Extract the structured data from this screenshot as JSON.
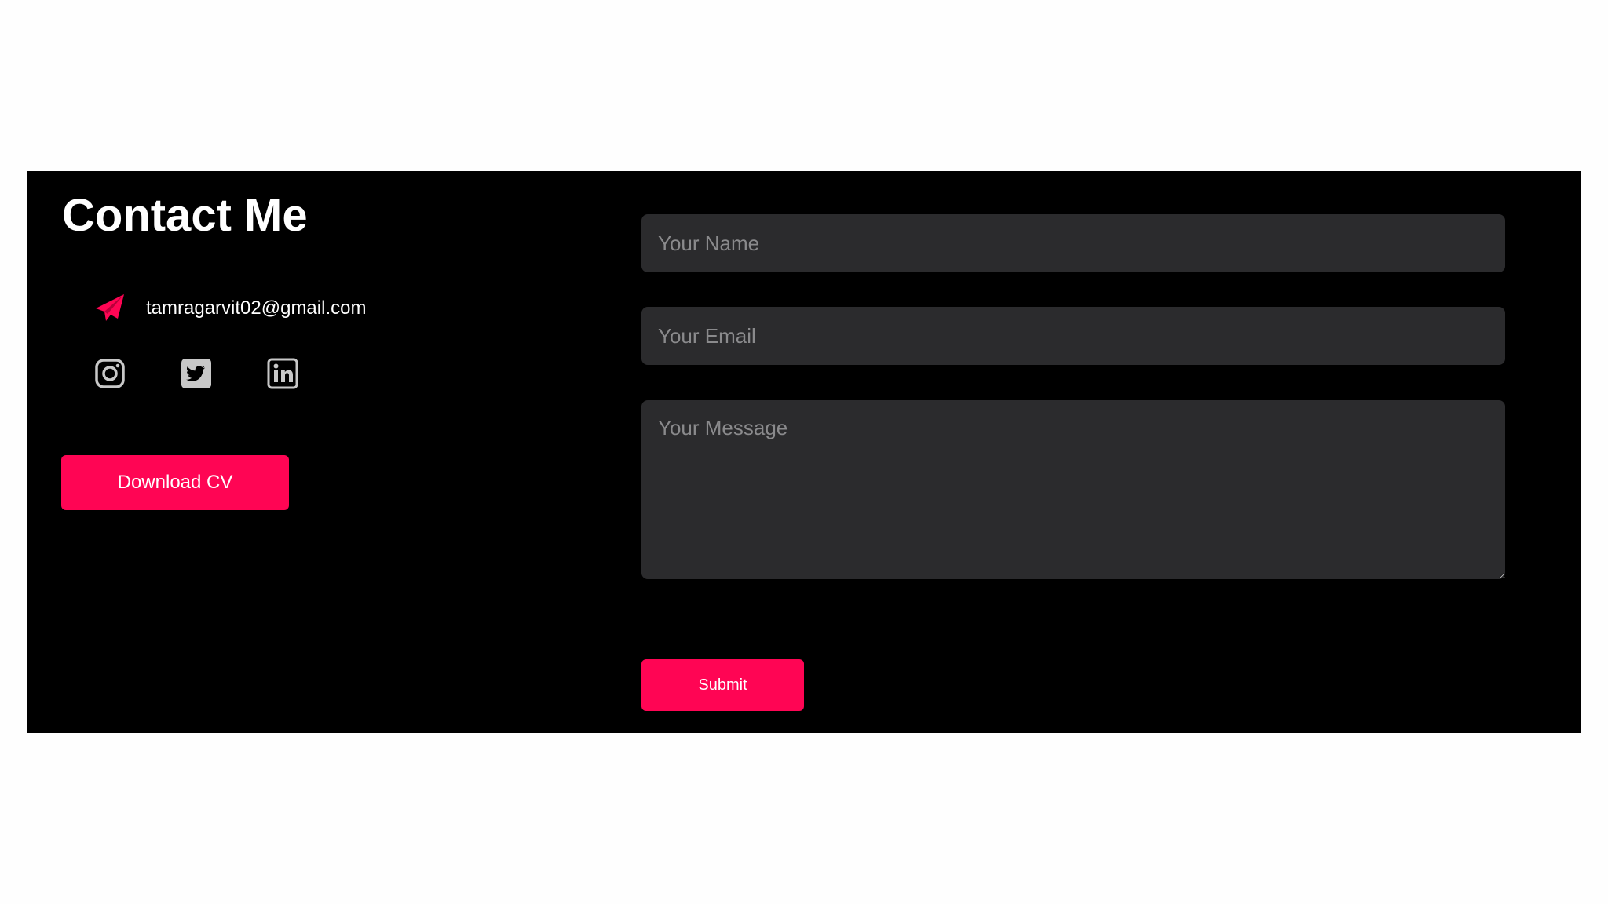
{
  "contact": {
    "title": "Contact Me",
    "email": "tamragarvit02@gmail.com",
    "download_label": "Download CV",
    "socials": [
      {
        "name": "instagram",
        "icon": "instagram-icon"
      },
      {
        "name": "twitter",
        "icon": "twitter-icon"
      },
      {
        "name": "linkedin",
        "icon": "linkedin-icon"
      }
    ]
  },
  "form": {
    "name_placeholder": "Your Name",
    "email_placeholder": "Your Email",
    "message_placeholder": "Your Message",
    "submit_label": "Submit"
  },
  "colors": {
    "accent": "#ff0554",
    "background": "#000000",
    "field_bg": "#2b2b2d",
    "icon_gray": "#c8c8c8"
  }
}
